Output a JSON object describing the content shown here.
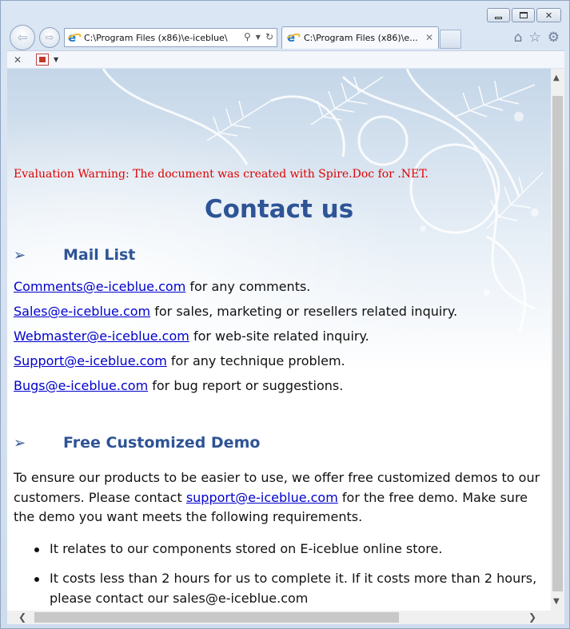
{
  "browser": {
    "address": "C:\\Program Files (x86)\\e-iceblue\\",
    "tab_title": "C:\\Program Files (x86)\\e...",
    "icons": [
      "back-icon",
      "forward-icon",
      "search-icon",
      "dropdown-icon",
      "refresh-icon",
      "home-icon",
      "favorites-icon",
      "settings-icon",
      "close-tab-icon",
      "pdf-icon"
    ]
  },
  "page": {
    "eval_warning": "Evaluation Warning: The document was created with Spire.Doc for .NET.",
    "title": "Contact us",
    "mail_section": {
      "arrow": "➢",
      "heading": "Mail List",
      "items": [
        {
          "email": "Comments@e-iceblue.com",
          "text": " for any comments."
        },
        {
          "email": "Sales@e-iceblue.com",
          "text": " for sales, marketing or resellers related inquiry."
        },
        {
          "email": "Webmaster@e-iceblue.com",
          "text": " for web-site related inquiry."
        },
        {
          "email": "Support@e-iceblue.com",
          "text": " for any technique problem."
        },
        {
          "email": "Bugs@e-iceblue.com",
          "text": " for bug report or suggestions."
        }
      ]
    },
    "demo_section": {
      "arrow": "➢",
      "heading": "Free Customized Demo",
      "para_before": "To ensure our products to be easier to use, we offer free customized demos to our customers. Please contact ",
      "para_link": "support@e-iceblue.com",
      "para_after": " for the free demo. Make sure the demo you want meets the following requirements.",
      "bullets": [
        {
          "text": "It relates to our components stored on E-iceblue online store.",
          "link": ""
        },
        {
          "text": "It costs less than 2 hours for us to complete it. If it costs more than 2 hours, please contact our ",
          "link": "sales@e-iceblue.com"
        }
      ]
    }
  },
  "colors": {
    "heading": "#2e5496",
    "warning": "#e00000",
    "link": "#0000cc"
  }
}
